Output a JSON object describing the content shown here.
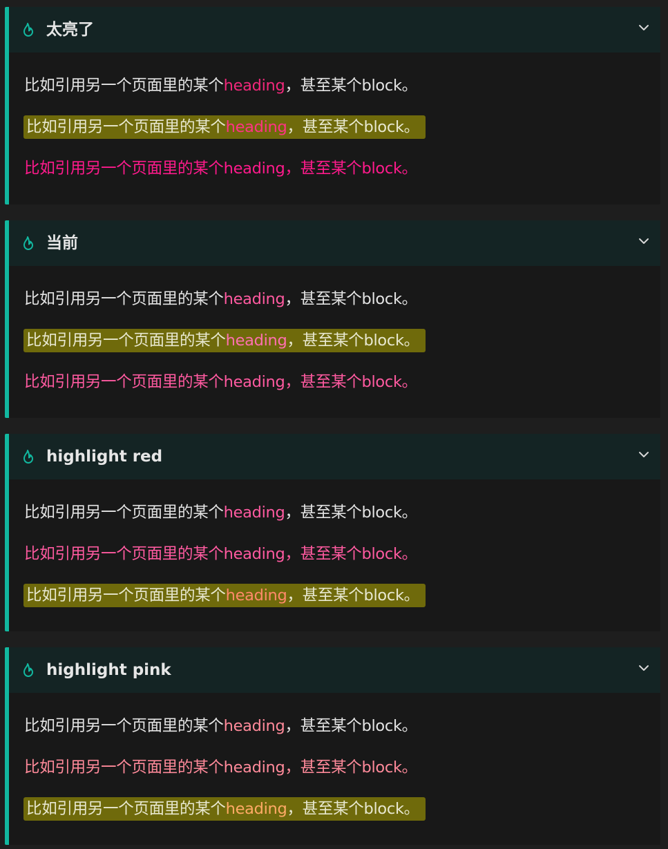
{
  "callouts": [
    {
      "title": "太亮了",
      "lines": [
        {
          "prefix": "比如引用另一个页面里的某个",
          "link": "heading",
          "suffix": "，甚至某个block。",
          "style": "plain"
        },
        {
          "prefix": "比如引用另一个页面里的某个",
          "link": "heading",
          "suffix": "，甚至某个block。",
          "style": "highlight"
        },
        {
          "prefix": "比如引用另一个页面里的某个",
          "link": "heading",
          "suffix": "，甚至某个block。",
          "style": "colored"
        }
      ],
      "colors": {
        "link": "#f0287a",
        "colored": "#ff1a8c",
        "hl_link": "#ff3385"
      }
    },
    {
      "title": "当前",
      "lines": [
        {
          "prefix": "比如引用另一个页面里的某个",
          "link": "heading",
          "suffix": "，甚至某个block。",
          "style": "plain"
        },
        {
          "prefix": "比如引用另一个页面里的某个",
          "link": "heading",
          "suffix": "，甚至某个block。",
          "style": "highlight"
        },
        {
          "prefix": "比如引用另一个页面里的某个",
          "link": "heading",
          "suffix": "，甚至某个block。",
          "style": "colored"
        }
      ],
      "colors": {
        "link": "#ff5aa0",
        "colored": "#ff5aa0",
        "hl_link": "#ff70b0"
      }
    },
    {
      "title": "highlight red",
      "lines": [
        {
          "prefix": "比如引用另一个页面里的某个",
          "link": "heading",
          "suffix": "，甚至某个block。",
          "style": "plain"
        },
        {
          "prefix": "比如引用另一个页面里的某个",
          "link": "heading",
          "suffix": "，甚至某个block。",
          "style": "colored"
        },
        {
          "prefix": "比如引用另一个页面里的某个",
          "link": "heading",
          "suffix": "，甚至某个block。",
          "style": "highlight"
        }
      ],
      "colors": {
        "link": "#ff5aa0",
        "colored": "#ff5aa0",
        "hl_link": "#ff8a6a"
      }
    },
    {
      "title": "highlight pink",
      "lines": [
        {
          "prefix": "比如引用另一个页面里的某个",
          "link": "heading",
          "suffix": "，甚至某个block。",
          "style": "plain"
        },
        {
          "prefix": "比如引用另一个页面里的某个",
          "link": "heading",
          "suffix": "，甚至某个block。",
          "style": "colored"
        },
        {
          "prefix": "比如引用另一个页面里的某个",
          "link": "heading",
          "suffix": "，甚至某个block。",
          "style": "highlight"
        }
      ],
      "colors": {
        "link": "#ff8a9a",
        "colored": "#ff8a9a",
        "hl_link": "#ffaa66"
      }
    }
  ],
  "base_colors": {
    "text": "#e4e4e4",
    "accent": "#12b8a0",
    "highlight_bg": "#6f6a0b",
    "highlight_text": "#e8e8d0"
  },
  "icons": {
    "callout": "flame-icon",
    "collapse": "chevron-down-icon"
  }
}
